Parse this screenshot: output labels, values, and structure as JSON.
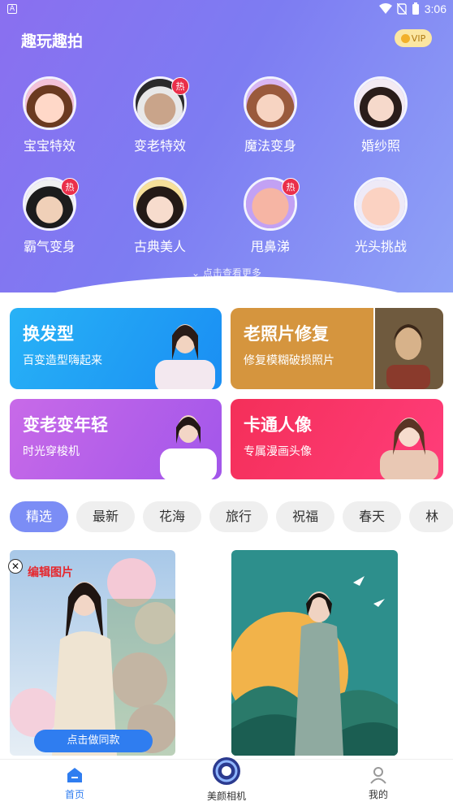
{
  "status": {
    "left_icon": "A",
    "time": "3:06"
  },
  "header": {
    "title": "趣玩趣拍",
    "vip_label": "VIP"
  },
  "effects": [
    {
      "label": "宝宝特效",
      "hot": ""
    },
    {
      "label": "变老特效",
      "hot": "热"
    },
    {
      "label": "魔法变身",
      "hot": ""
    },
    {
      "label": "婚纱照",
      "hot": ""
    },
    {
      "label": "霸气变身",
      "hot": "热"
    },
    {
      "label": "古典美人",
      "hot": ""
    },
    {
      "label": "甩鼻涕",
      "hot": "热"
    },
    {
      "label": "光头挑战",
      "hot": ""
    }
  ],
  "more_label": "点击查看更多",
  "features": [
    {
      "title": "换发型",
      "subtitle": "百变造型嗨起来",
      "color": "#1a9df5"
    },
    {
      "title": "老照片修复",
      "subtitle": "修复模糊破损照片",
      "color": "#d5953e"
    },
    {
      "title": "变老变年轻",
      "subtitle": "时光穿梭机",
      "color": "#b155e8"
    },
    {
      "title": "卡通人像",
      "subtitle": "专属漫画头像",
      "color": "#f0365e"
    }
  ],
  "tabs": [
    "精选",
    "最新",
    "花海",
    "旅行",
    "祝福",
    "春天",
    "林"
  ],
  "cards": {
    "edit_label": "编辑图片",
    "cta_label": "点击做同款"
  },
  "nav": {
    "home": "首页",
    "camera": "美颜相机",
    "me": "我的"
  },
  "colors": {
    "accent": "#7b8df5",
    "hot_badge": "#ea2f4a",
    "nav_active": "#2f7df0"
  }
}
